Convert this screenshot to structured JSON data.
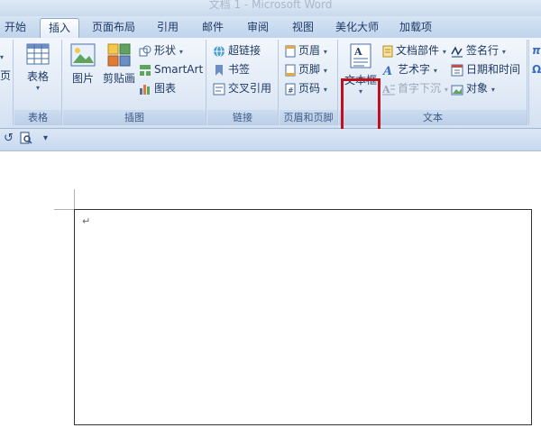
{
  "window": {
    "title": "文档 1 - Microsoft Word"
  },
  "tabs": [
    "开始",
    "插入",
    "页面布局",
    "引用",
    "邮件",
    "审阅",
    "视图",
    "美化大师",
    "加载项"
  ],
  "active_tab": "插入",
  "ribbon": {
    "cut_left": {
      "item1": "页"
    },
    "tables": {
      "label": "表格",
      "table_button": "表格"
    },
    "illustrations": {
      "label": "插图",
      "picture": "图片",
      "clipart": "剪贴画",
      "shapes": "形状",
      "smartart": "SmartArt",
      "chart": "图表"
    },
    "links": {
      "label": "链接",
      "hyperlink": "超链接",
      "bookmark": "书签",
      "crossref": "交叉引用"
    },
    "header_footer": {
      "label": "页眉和页脚",
      "header": "页眉",
      "footer": "页脚",
      "page_number": "页码"
    },
    "text": {
      "label": "文本",
      "textbox": "文本框",
      "quickparts": "文档部件",
      "wordart": "艺术字",
      "dropcap": "首字下沉",
      "signature": "签名行",
      "datetime": "日期和时间",
      "object": "对象"
    }
  },
  "quick_access": {
    "undo_icon": "undo-icon",
    "preview_icon": "print-preview-icon",
    "customize": "▾"
  },
  "document": {
    "paragraph_mark": "↵"
  },
  "colors": {
    "highlight": "#c0101e",
    "ribbon": "#dfe9f5",
    "accent": "#1e3a66"
  }
}
